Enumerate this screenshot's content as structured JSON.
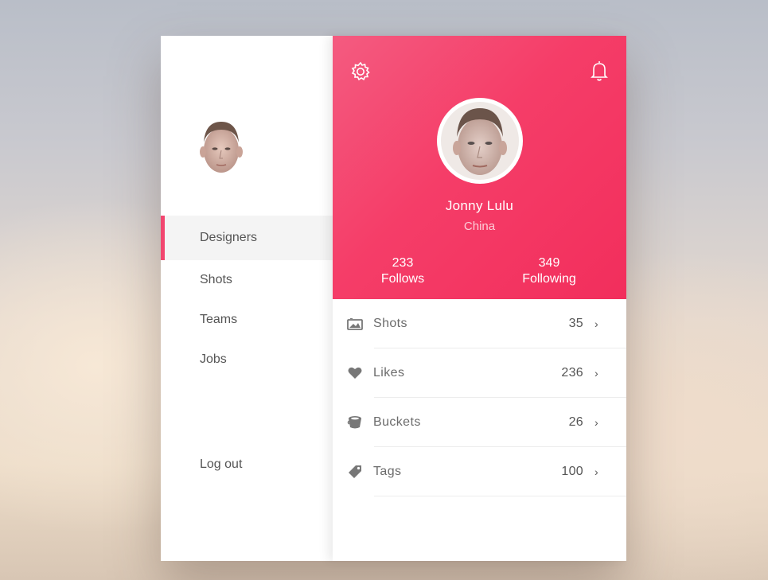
{
  "sidebar": {
    "nav": [
      {
        "label": "Designers",
        "active": true
      },
      {
        "label": "Shots"
      },
      {
        "label": "Teams"
      },
      {
        "label": "Jobs"
      }
    ],
    "logout_label": "Log out"
  },
  "profile": {
    "name": "Jonny Lulu",
    "location": "China",
    "follows_count": "233",
    "follows_label": "Follows",
    "following_count": "349",
    "following_label": "Following"
  },
  "stats": [
    {
      "label": "Shots",
      "count": "35",
      "icon": "gallery-icon"
    },
    {
      "label": "Likes",
      "count": "236",
      "icon": "heart-icon"
    },
    {
      "label": "Buckets",
      "count": "26",
      "icon": "bucket-icon"
    },
    {
      "label": "Tags",
      "count": "100",
      "icon": "tag-icon"
    }
  ],
  "chevron": "›",
  "colors": {
    "accent": "#f53d68",
    "text": "#555555"
  }
}
